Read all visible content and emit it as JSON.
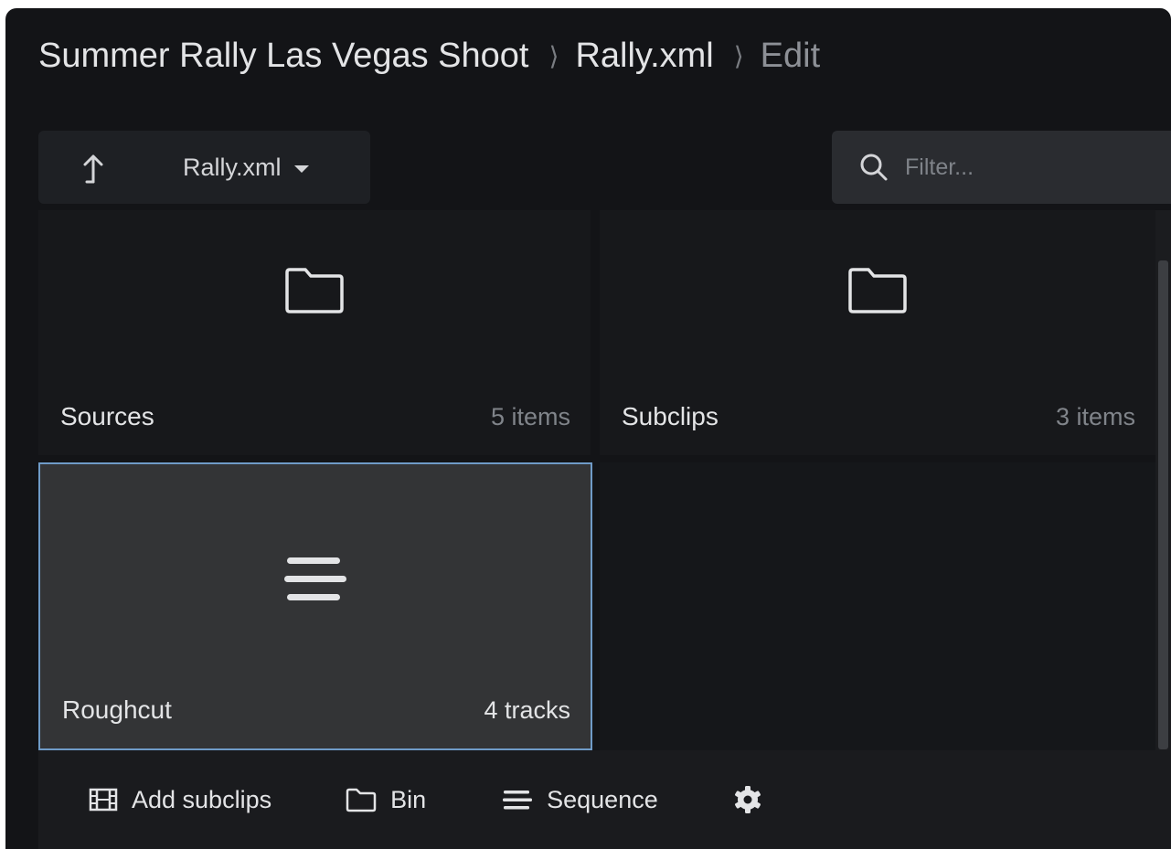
{
  "breadcrumb": {
    "project": "Summer Rally Las Vegas Shoot",
    "file": "Rally.xml",
    "current": "Edit",
    "separator": "⟩"
  },
  "toolbar": {
    "up_icon": "arrow-up-icon",
    "file_select_value": "Rally.xml",
    "search_placeholder": "Filter..."
  },
  "items": [
    {
      "name": "Sources",
      "count": "5 items",
      "icon": "folder-icon"
    },
    {
      "name": "Subclips",
      "count": "3 items",
      "icon": "folder-icon"
    },
    {
      "name": "Roughcut",
      "count": "4 tracks",
      "icon": "sequence-icon",
      "selected": true
    }
  ],
  "bottom_bar": {
    "add_subclips": "Add subclips",
    "bin": "Bin",
    "sequence": "Sequence",
    "settings_icon": "gear-icon"
  },
  "colors": {
    "background": "#131417",
    "tile": "#17181b",
    "selected_tile": "#333436",
    "selection_border": "#6f9bc7"
  }
}
